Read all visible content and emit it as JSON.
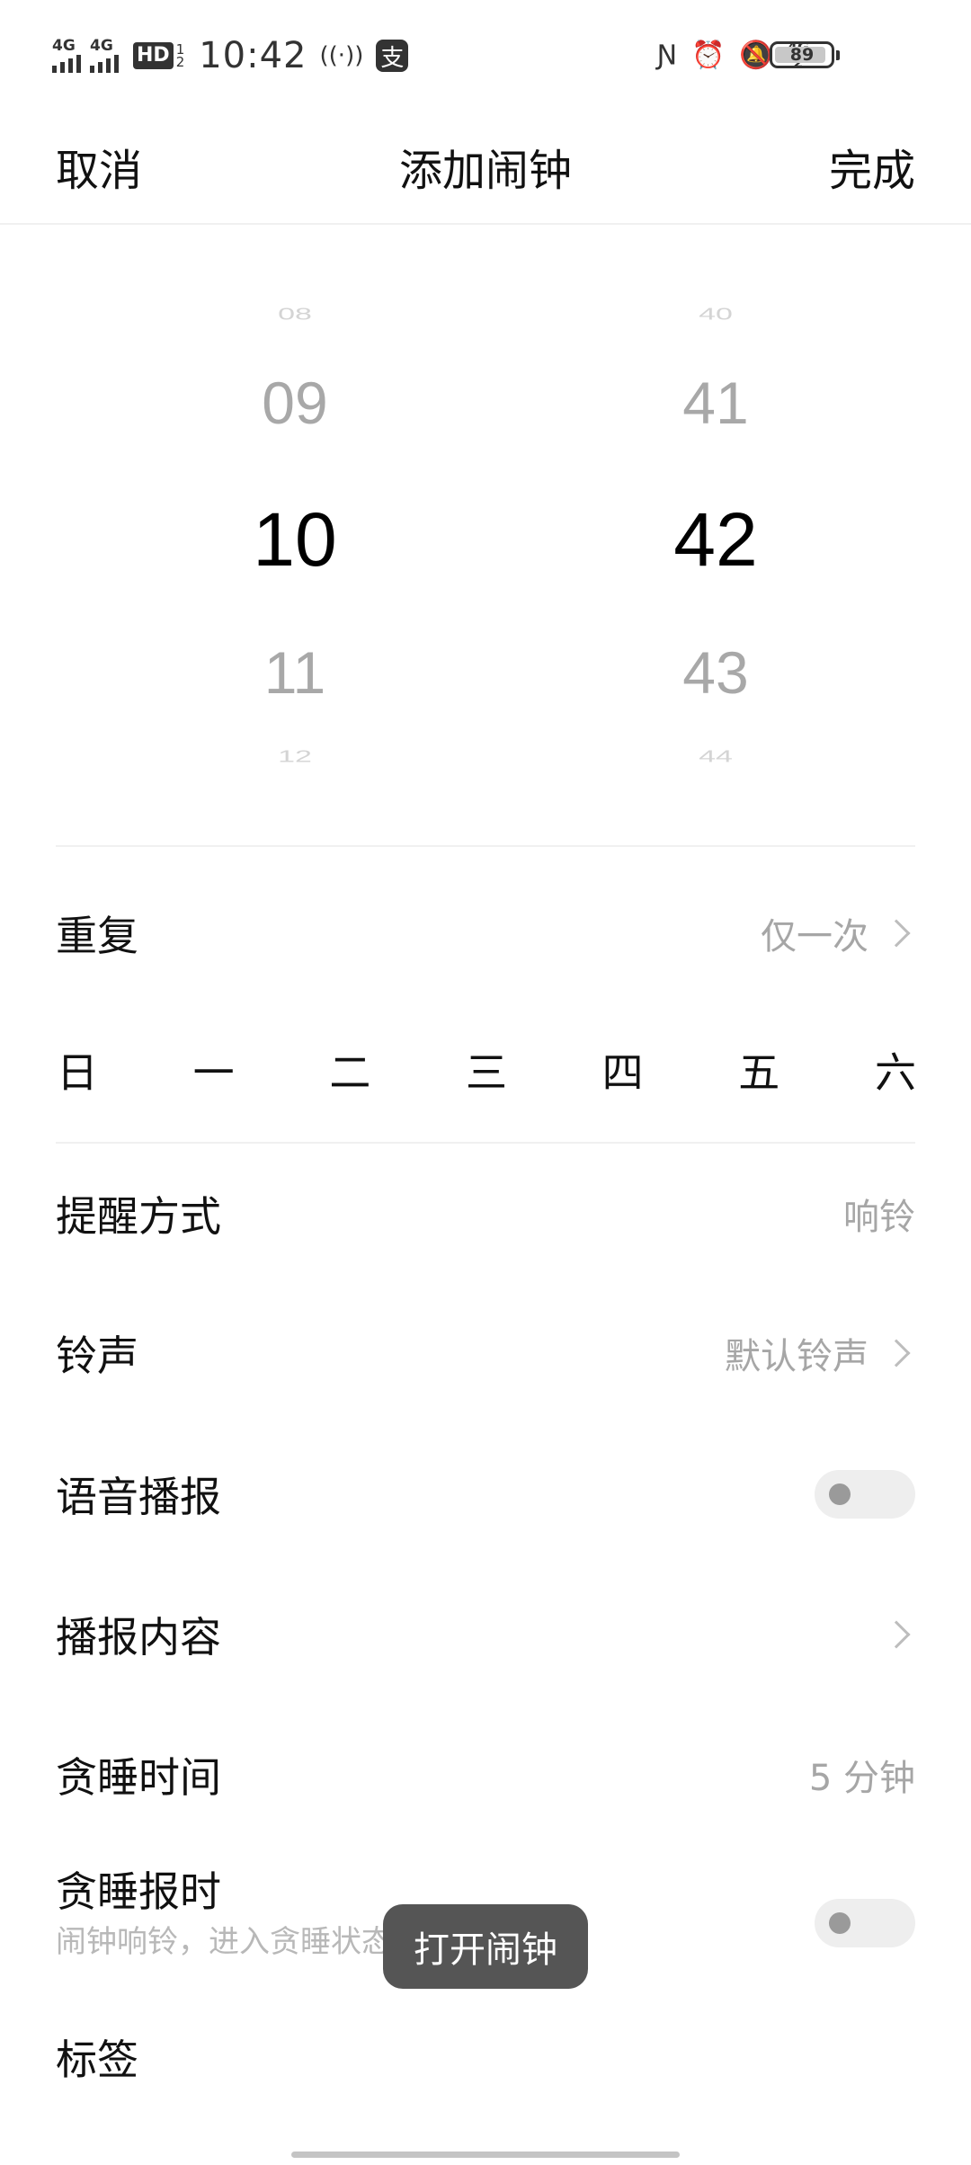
{
  "status_bar": {
    "network_1": "4G",
    "network_2": "4G",
    "hd_label": "HD",
    "hd_sub_1": "1",
    "hd_sub_2": "2",
    "time": "10:42",
    "pay_glyph": "支",
    "network_3": "4G",
    "network_3_sub": "2",
    "battery_level": "89",
    "icons": [
      "signal-icon",
      "signal-icon",
      "hd-call-icon",
      "hotspot-icon",
      "alipay-icon",
      "nfc-icon",
      "alarm-icon",
      "mute-icon",
      "data-icon",
      "battery-icon"
    ]
  },
  "header": {
    "cancel_label": "取消",
    "title": "添加闹钟",
    "done_label": "完成"
  },
  "picker": {
    "hours": [
      "08",
      "09",
      "10",
      "11",
      "12"
    ],
    "minutes": [
      "40",
      "41",
      "42",
      "43",
      "44"
    ],
    "selected_hour": "10",
    "selected_minute": "42"
  },
  "repeat": {
    "label": "重复",
    "value": "仅一次",
    "days": [
      "日",
      "一",
      "二",
      "三",
      "四",
      "五",
      "六"
    ]
  },
  "reminder": {
    "label": "提醒方式",
    "value": "响铃"
  },
  "ringtone": {
    "label": "铃声",
    "value": "默认铃声"
  },
  "voice_broadcast": {
    "label": "语音播报",
    "enabled": false
  },
  "broadcast_content": {
    "label": "播报内容"
  },
  "snooze_time": {
    "label": "贪睡时间",
    "value": "5 分钟"
  },
  "snooze_announce": {
    "label": "贪睡报时",
    "description": "闹钟响铃，进入贪睡状态后",
    "description_tail": "时间",
    "enabled": false
  },
  "tag": {
    "label": "标签"
  },
  "toast": {
    "text": "打开闹钟"
  },
  "colors": {
    "accent_text": "#111111",
    "secondary_text": "#a6a6a6",
    "toast_bg": "#555555",
    "toggle_off": "#eeeeee"
  }
}
